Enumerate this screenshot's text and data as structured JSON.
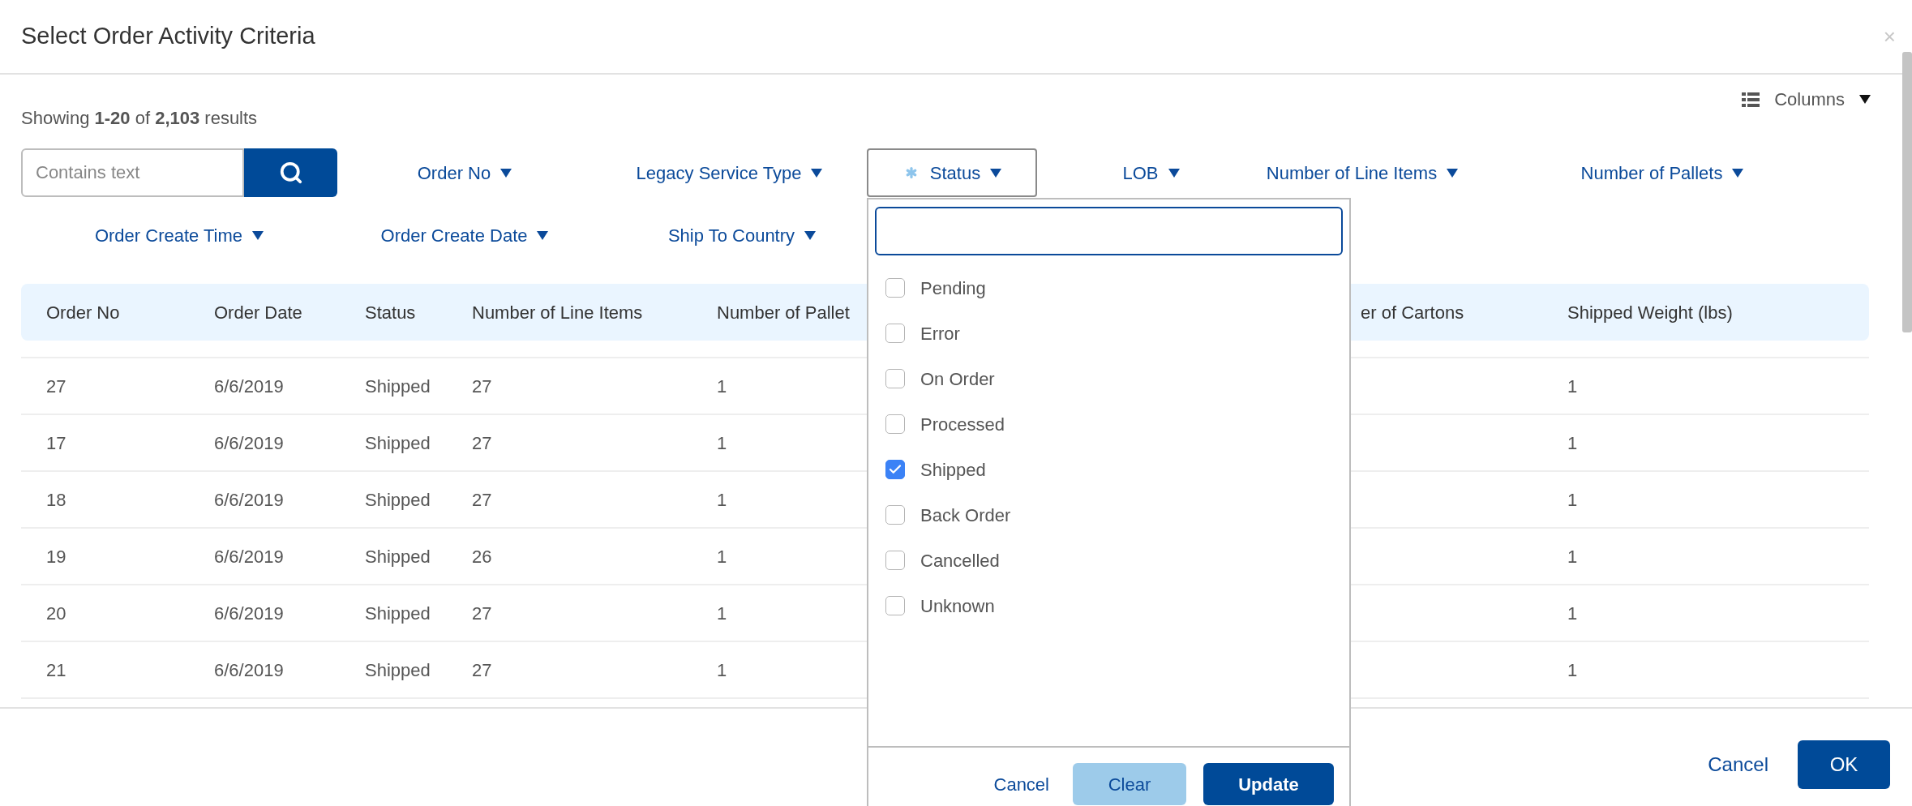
{
  "dialog": {
    "title": "Select Order Activity Criteria",
    "close": "×"
  },
  "results_summary": "Showing **1-20** of **2,103** results",
  "columns_button": "Columns",
  "search": {
    "placeholder": "Contains text"
  },
  "filters": [
    {
      "label": "Order No",
      "expanded": false,
      "active": false
    },
    {
      "label": "Legacy Service Type",
      "expanded": false,
      "active": false
    },
    {
      "label": "Status",
      "expanded": true,
      "active": true
    },
    {
      "label": "LOB",
      "expanded": false,
      "active": false
    },
    {
      "label": "Number of Line Items",
      "expanded": false,
      "active": false
    },
    {
      "label": "Number of Pallets",
      "expanded": false,
      "active": false
    },
    {
      "label": "Order Create Time",
      "expanded": false,
      "active": false
    },
    {
      "label": "Order Create Date",
      "expanded": false,
      "active": false
    },
    {
      "label": "Ship To Country",
      "expanded": false,
      "active": false
    }
  ],
  "status_menu": {
    "options": [
      {
        "label": "Pending",
        "checked": false
      },
      {
        "label": "Error",
        "checked": false
      },
      {
        "label": "On Order",
        "checked": false
      },
      {
        "label": "Processed",
        "checked": false
      },
      {
        "label": "Shipped",
        "checked": true
      },
      {
        "label": "Back Order",
        "checked": false
      },
      {
        "label": "Cancelled",
        "checked": false
      },
      {
        "label": "Unknown",
        "checked": false
      }
    ],
    "buttons": {
      "cancel": "Cancel",
      "clear": "Clear",
      "update": "Update"
    }
  },
  "table": {
    "columns": [
      "Order No",
      "Order Date",
      "Status",
      "Number of Line Items",
      "Number of Pallet",
      "er of Cartons",
      "Shipped Weight (lbs)"
    ],
    "rows": [
      {
        "cells": [
          "27",
          "6/6/2019",
          "Shipped",
          "27",
          "1",
          "1"
        ]
      },
      {
        "cells": [
          "17",
          "6/6/2019",
          "Shipped",
          "27",
          "1",
          "1"
        ]
      },
      {
        "cells": [
          "18",
          "6/6/2019",
          "Shipped",
          "27",
          "1",
          "1"
        ]
      },
      {
        "cells": [
          "19",
          "6/6/2019",
          "Shipped",
          "26",
          "1",
          "1"
        ]
      },
      {
        "cells": [
          "20",
          "6/6/2019",
          "Shipped",
          "27",
          "1",
          "1"
        ]
      },
      {
        "cells": [
          "21",
          "6/6/2019",
          "Shipped",
          "27",
          "1",
          "1"
        ]
      }
    ]
  },
  "footer": {
    "cancel": "Cancel",
    "ok": "OK"
  }
}
